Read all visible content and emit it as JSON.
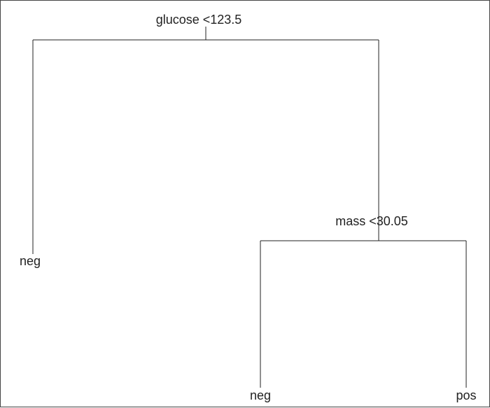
{
  "chart_data": {
    "type": "tree",
    "description": "Decision tree diagram",
    "nodes": [
      {
        "id": "root",
        "label": "glucose <123.5",
        "split_feature": "glucose",
        "split_threshold": 123.5,
        "children": [
          "left_leaf",
          "right_node"
        ]
      },
      {
        "id": "right_node",
        "label": "mass <30.05",
        "split_feature": "mass",
        "split_threshold": 30.05,
        "children": [
          "right_left_leaf",
          "right_right_leaf"
        ]
      },
      {
        "id": "left_leaf",
        "label": "neg",
        "leaf": true,
        "class": "neg"
      },
      {
        "id": "right_left_leaf",
        "label": "neg",
        "leaf": true,
        "class": "neg"
      },
      {
        "id": "right_right_leaf",
        "label": "pos",
        "leaf": true,
        "class": "pos"
      }
    ]
  },
  "labels": {
    "root_split": "glucose <123.5",
    "right_split": "mass <30.05",
    "leaf_left": "neg",
    "leaf_right_left": "neg",
    "leaf_right_right": "pos"
  }
}
